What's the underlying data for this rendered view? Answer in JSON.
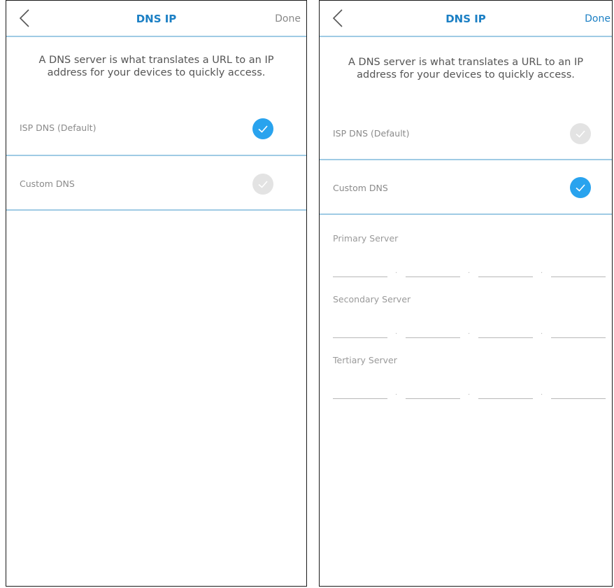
{
  "screens": [
    {
      "title": "DNS IP",
      "done_label": "Done",
      "description": "A DNS server is what translates a URL to an IP address for your devices to quickly access.",
      "options": [
        {
          "label": "ISP DNS (Default)",
          "selected": true
        },
        {
          "label": "Custom DNS",
          "selected": false
        }
      ]
    },
    {
      "title": "DNS IP",
      "done_label": "Done",
      "description": "A DNS server is what translates a URL to an IP address for your devices to quickly access.",
      "options": [
        {
          "label": "ISP DNS (Default)",
          "selected": false
        },
        {
          "label": "Custom DNS",
          "selected": true
        }
      ],
      "servers": [
        {
          "label": "Primary Server",
          "octets": [
            "",
            "",
            "",
            ""
          ]
        },
        {
          "label": "Secondary Server",
          "octets": [
            "",
            "",
            "",
            ""
          ]
        },
        {
          "label": "Tertiary Server",
          "octets": [
            "",
            "",
            "",
            ""
          ]
        }
      ]
    }
  ],
  "icons": {
    "back": "chevron-left-icon",
    "check": "check-icon"
  },
  "colors": {
    "accent": "#29a3ee",
    "title": "#1b7fc4",
    "divider": "#9fcbe4",
    "unchecked": "#e3e3e3"
  }
}
